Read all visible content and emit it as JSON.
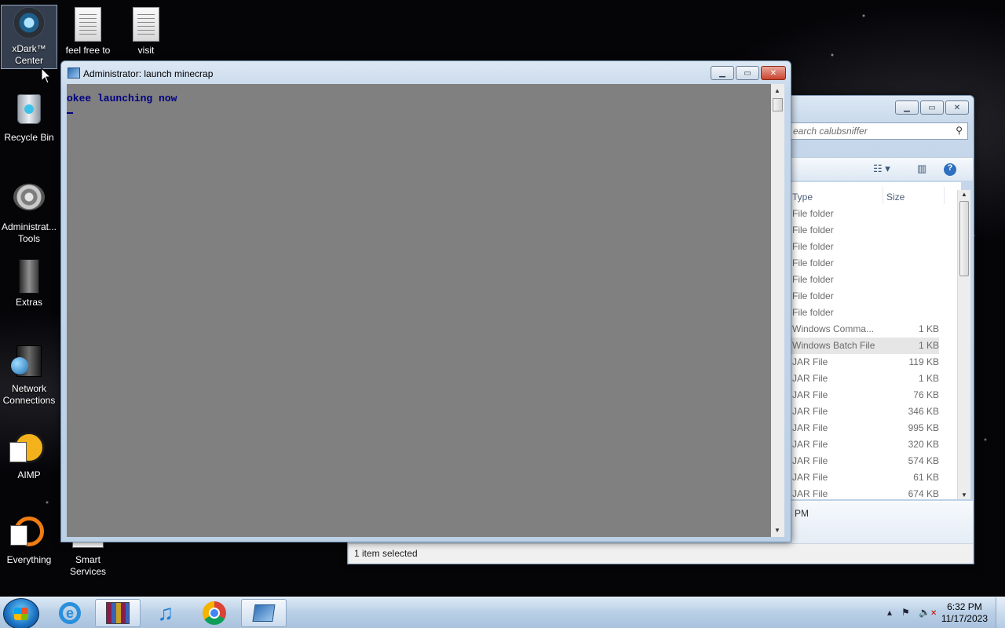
{
  "desktop": {
    "icons": [
      {
        "label": "xDark™ Center",
        "icon": "xdark-center-icon"
      },
      {
        "label": "feel free to",
        "icon": "text-document-icon"
      },
      {
        "label": "visit",
        "icon": "text-document-icon"
      },
      {
        "label": "Recycle Bin",
        "icon": "recycle-bin-icon"
      },
      {
        "label": "Administrat... Tools",
        "icon": "administrative-tools-icon"
      },
      {
        "label": "Extras",
        "icon": "folder-icon"
      },
      {
        "label": "Network Connections",
        "icon": "network-connections-icon"
      },
      {
        "label": "AIMP",
        "icon": "aimp-shortcut-icon"
      },
      {
        "label": "Everything",
        "icon": "everything-shortcut-icon"
      },
      {
        "label": "Smart Services",
        "icon": "smart-services-icon"
      }
    ]
  },
  "console": {
    "title": "Administrator:  launch minecrap",
    "output_line": "okee launching now",
    "buttons": {
      "minimize": "▁",
      "maximize": "▭",
      "close": "✕"
    }
  },
  "explorer": {
    "search_placeholder": "earch calubsniffer",
    "columns": {
      "type": "Type",
      "size": "Size"
    },
    "rows": [
      {
        "type": "File folder",
        "size": ""
      },
      {
        "type": "File folder",
        "size": ""
      },
      {
        "type": "File folder",
        "size": ""
      },
      {
        "type": "File folder",
        "size": ""
      },
      {
        "type": "File folder",
        "size": ""
      },
      {
        "type": "File folder",
        "size": ""
      },
      {
        "type": "File folder",
        "size": ""
      },
      {
        "type": "Windows Comma...",
        "size": "1 KB"
      },
      {
        "type": "Windows Batch File",
        "size": "1 KB"
      },
      {
        "type": "JAR File",
        "size": "119 KB"
      },
      {
        "type": "JAR File",
        "size": "1 KB"
      },
      {
        "type": "JAR File",
        "size": "76 KB"
      },
      {
        "type": "JAR File",
        "size": "346 KB"
      },
      {
        "type": "JAR File",
        "size": "995 KB"
      },
      {
        "type": "JAR File",
        "size": "320 KB"
      },
      {
        "type": "JAR File",
        "size": "574 KB"
      },
      {
        "type": "JAR File",
        "size": "61 KB"
      },
      {
        "type": "JAR File",
        "size": "674 KB"
      }
    ],
    "highlighted_row": 8,
    "details_time": "PM",
    "status": "1 item selected"
  },
  "taskbar": {
    "items": [
      {
        "name": "internet-explorer-icon"
      },
      {
        "name": "winrar-icon"
      },
      {
        "name": "music-player-icon"
      },
      {
        "name": "chrome-icon"
      },
      {
        "name": "command-prompt-icon"
      }
    ],
    "active_item": 4,
    "clock_time": "6:32 PM",
    "clock_date": "11/17/2023"
  }
}
